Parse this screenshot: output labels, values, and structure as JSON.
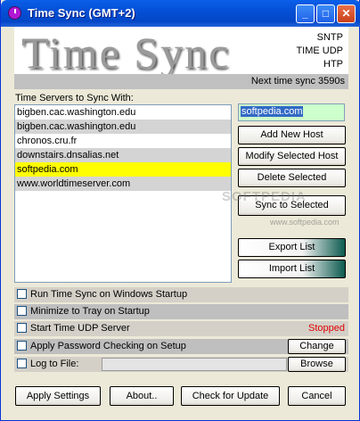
{
  "window": {
    "title": "Time Sync (GMT+2)",
    "icon": "clock-icon"
  },
  "banner": {
    "logo_text": "Time Sync",
    "protocols": [
      "SNTP",
      "TIME UDP",
      "HTP"
    ]
  },
  "status": {
    "next_sync": "Next time sync 3590s",
    "server_state": "Stopped",
    "state_color": "#e00000"
  },
  "servers": {
    "label": "Time Servers to Sync With:",
    "items": [
      "bigben.cac.washington.edu",
      "bigben.cac.washington.edu",
      "chronos.cru.fr",
      "downstairs.dnsalias.net",
      "softpedia.com",
      "www.worldtimeserver.com"
    ],
    "selected_index": 4
  },
  "host_input": {
    "value": "softpedia.com"
  },
  "buttons": {
    "add": "Add New Host",
    "modify": "Modify Selected Host",
    "delete": "Delete Selected",
    "sync": "Sync to Selected",
    "export": "Export List",
    "import": "Import List",
    "change": "Change",
    "browse": "Browse",
    "apply": "Apply Settings",
    "about": "About..",
    "update": "Check for Update",
    "cancel": "Cancel"
  },
  "options": [
    "Run Time Sync on Windows Startup",
    "Minimize to Tray on Startup",
    "Start Time UDP Server",
    "Apply Password Checking on Setup",
    "Log to File:"
  ],
  "watermark": {
    "main": "SOFTPEDIA",
    "sub": "www.softpedia.com"
  }
}
